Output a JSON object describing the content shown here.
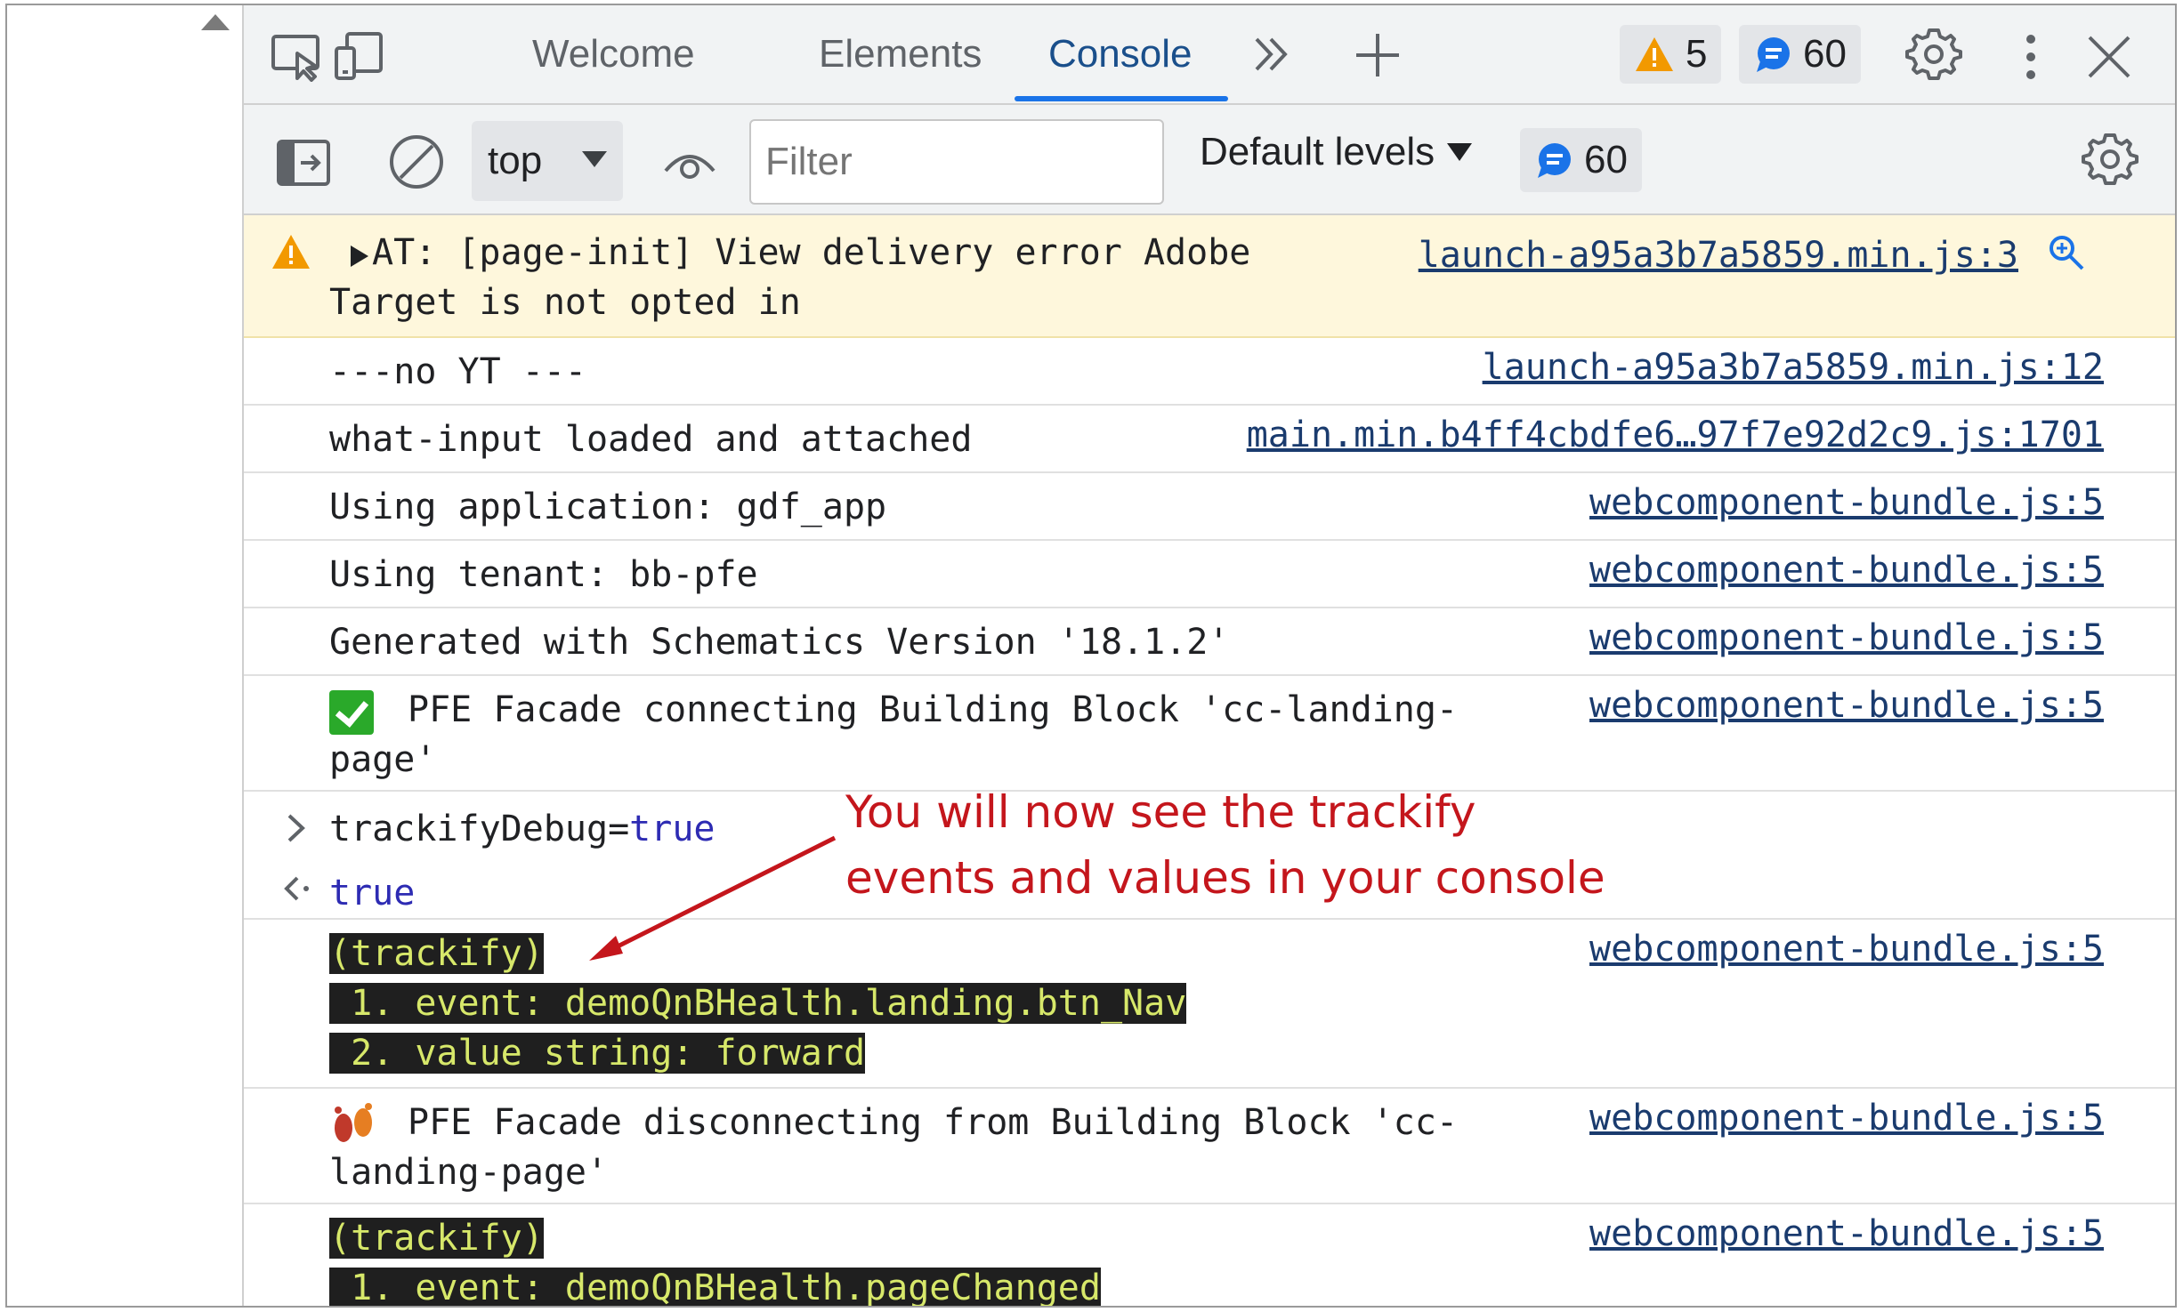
{
  "tabs": [
    {
      "label": "Welcome",
      "active": false
    },
    {
      "label": "Elements",
      "active": false
    },
    {
      "label": "Console",
      "active": true
    }
  ],
  "badges": {
    "warnings": "5",
    "messages": "60"
  },
  "toolbar": {
    "context": "top",
    "filter_placeholder": "Filter",
    "levels": "Default levels",
    "message_count": "60"
  },
  "console": {
    "warning": {
      "text": "AT: [page-init] View delivery error Adobe\nTarget is not opted in",
      "source": "launch-a95a3b7a5859.min.js:3"
    },
    "rows": [
      {
        "text": "---no YT ---",
        "source": "launch-a95a3b7a5859.min.js:12"
      },
      {
        "text": "what-input loaded and attached",
        "source": "main.min.b4ff4cbdfe6…97f7e92d2c9.js:1701"
      },
      {
        "text": "Using application: gdf_app",
        "source": "webcomponent-bundle.js:5"
      },
      {
        "text": "Using tenant: bb-pfe",
        "source": "webcomponent-bundle.js:5"
      },
      {
        "text": "Generated with Schematics Version '18.1.2'",
        "source": "webcomponent-bundle.js:5"
      },
      {
        "text": "PFE Facade connecting Building Block 'cc-landing-\npage'",
        "source": "webcomponent-bundle.js:5"
      }
    ],
    "input": {
      "name": "trackifyDebug",
      "op": "=",
      "value": "true"
    },
    "output": "true",
    "trackify_1": {
      "tag": "(trackify)",
      "line1": " 1. event: demoQnBHealth.landing.btn_Nav",
      "line2": " 2. value string: forward",
      "source": "webcomponent-bundle.js:5"
    },
    "disconnect": {
      "text": "PFE Facade disconnecting from Building Block 'cc-\nlanding-page'",
      "source": "webcomponent-bundle.js:5"
    },
    "trackify_2": {
      "tag": "(trackify)",
      "line1": " 1. event: demoQnBHealth.pageChanged",
      "source": "webcomponent-bundle.js:5"
    }
  },
  "annotation": "You will now see the trackify\nevents and values in your console",
  "colors": {
    "accent": "#1a73e8",
    "annotation": "#c4161c",
    "warning_bg": "#fef7dc",
    "trackify_text": "#d7e86a"
  }
}
